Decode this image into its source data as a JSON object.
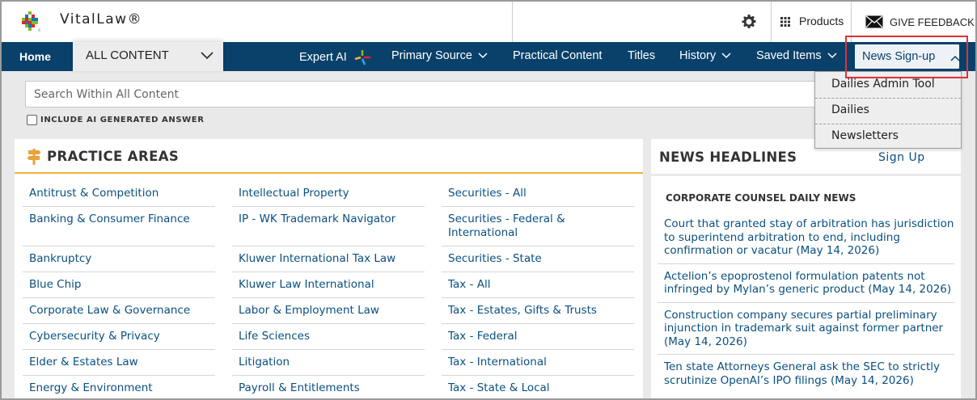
{
  "header": {
    "brand": "VitalLaw®",
    "products_label": "Products",
    "feedback_label": "GIVE FEEDBACK"
  },
  "nav": {
    "home": "Home",
    "scope_selected": "ALL CONTENT",
    "expert_ai": "Expert AI",
    "primary_source": "Primary Source",
    "practical_content": "Practical Content",
    "titles": "Titles",
    "history": "History",
    "saved_items": "Saved Items",
    "news_signup": "News Sign-up"
  },
  "news_menu": {
    "items": [
      "Dailies Admin Tool",
      "Dailies",
      "Newsletters"
    ]
  },
  "search": {
    "placeholder": "Search Within All Content",
    "ai_checkbox_label": "INCLUDE AI GENERATED ANSWER"
  },
  "practice_areas": {
    "title": "PRACTICE AREAS",
    "columns": [
      [
        "Antitrust & Competition",
        "Banking & Consumer Finance",
        "Bankruptcy",
        "Blue Chip",
        "Corporate Law & Governance",
        "Cybersecurity & Privacy",
        "Elder & Estates Law",
        "Energy & Environment"
      ],
      [
        "Intellectual Property",
        "IP - WK Trademark Navigator",
        "Kluwer International Tax Law",
        "Kluwer Law International",
        "Labor & Employment Law",
        "Life Sciences",
        "Litigation",
        "Payroll & Entitlements"
      ],
      [
        "Securities - All",
        "Securities - Federal & International",
        "Securities - State",
        "Tax - All",
        "Tax - Estates, Gifts & Trusts",
        "Tax - Federal",
        "Tax - International",
        "Tax - State & Local"
      ]
    ]
  },
  "news_headlines": {
    "title": "NEWS HEADLINES",
    "signup": "Sign Up",
    "section": "CORPORATE COUNSEL DAILY NEWS",
    "items": [
      "Court that granted stay of arbitration has jurisdiction to superintend arbitration to end, including confirmation or vacatur (May 14, 2026)",
      "Actelion’s epoprostenol formulation patents not infringed by Mylan’s generic product (May 14, 2026)",
      "Construction company secures partial preliminary injunction in trademark suit against former partner (May 14, 2026)",
      "Ten state Attorneys General ask the SEC to strictly scrutinize OpenAI’s IPO filings (May 14, 2026)"
    ]
  },
  "colors": {
    "nav_bg": "#0a416b",
    "link": "#0a4f7f",
    "accent": "#f0b33c",
    "highlight": "#e0313b"
  }
}
